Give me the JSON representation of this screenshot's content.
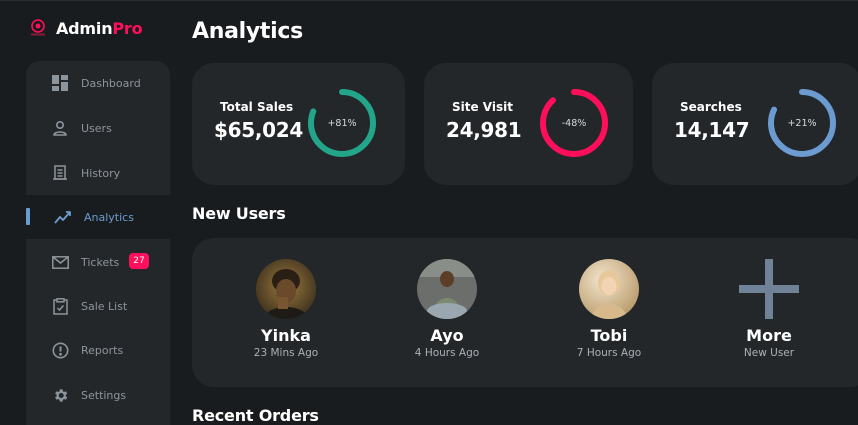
{
  "brand": {
    "name": "Admin",
    "accent": "Pro",
    "accent_color": "#ff0f5b"
  },
  "sidebar": {
    "items": [
      {
        "label": "Dashboard",
        "icon": "dashboard-icon"
      },
      {
        "label": "Users",
        "icon": "user-icon"
      },
      {
        "label": "History",
        "icon": "history-receipt-icon"
      },
      {
        "label": "Analytics",
        "icon": "analytics-chart-icon",
        "active": true
      },
      {
        "label": "Tickets",
        "icon": "mail-icon",
        "badge": "27"
      },
      {
        "label": "Sale List",
        "icon": "clipboard-check-icon"
      },
      {
        "label": "Reports",
        "icon": "alert-circle-icon"
      },
      {
        "label": "Settings",
        "icon": "gear-icon"
      }
    ]
  },
  "page": {
    "title": "Analytics"
  },
  "stats": [
    {
      "label": "Total Sales",
      "value": "$65,024",
      "percent": "+81%",
      "fraction": 0.81,
      "color": "#23a58a"
    },
    {
      "label": "Site Visit",
      "value": "24,981",
      "percent": "-48%",
      "fraction": 0.88,
      "color": "#ff0f5b"
    },
    {
      "label": "Searches",
      "value": "14,147",
      "percent": "+21%",
      "fraction": 0.82,
      "color": "#6c9bd2"
    }
  ],
  "new_users": {
    "title": "New Users",
    "users": [
      {
        "name": "Yinka",
        "time": "23 Mins Ago"
      },
      {
        "name": "Ayo",
        "time": "4 Hours Ago"
      },
      {
        "name": "Tobi",
        "time": "7 Hours Ago"
      },
      {
        "name": "More",
        "time": "New User",
        "icon": "plus-icon"
      }
    ]
  },
  "recent_orders": {
    "title": "Recent Orders"
  },
  "colors": {
    "accent_blue": "#6c9bd2",
    "accent_pink": "#ff0f5b",
    "card_bg": "#23272a",
    "page_bg": "#191c1e"
  }
}
